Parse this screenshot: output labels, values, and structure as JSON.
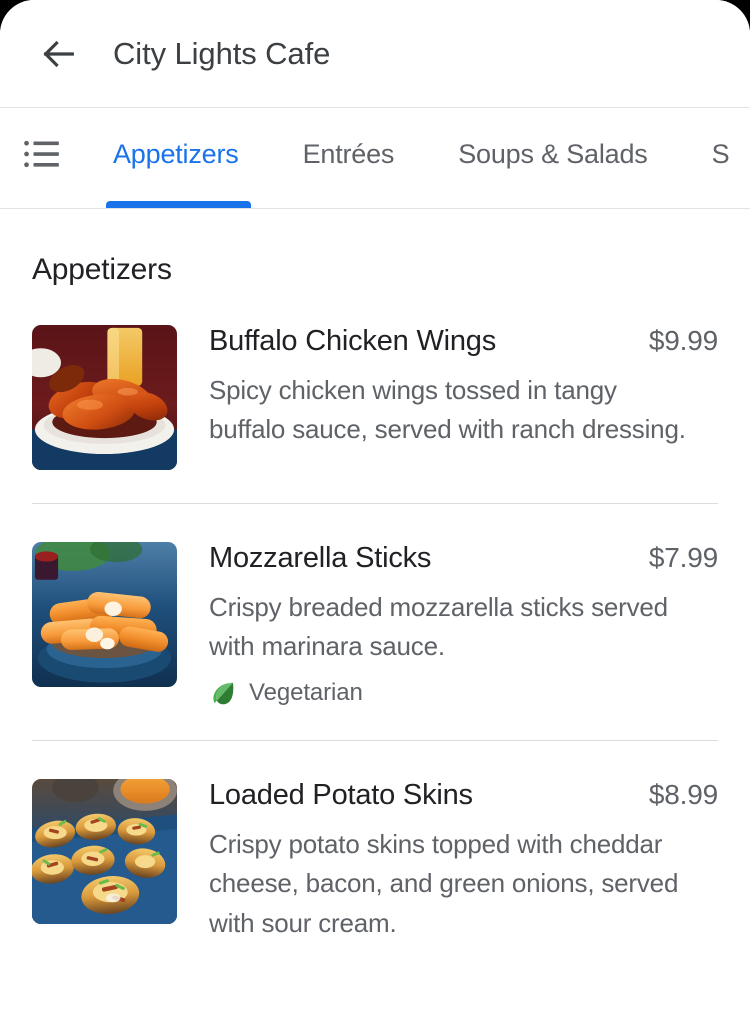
{
  "app": {
    "title": "City Lights Cafe",
    "back_icon": "arrow-left-icon",
    "accent_color": "#1a73e8",
    "text_color": "#3c4043",
    "muted_color": "#5f6368"
  },
  "tabs": {
    "list_icon": "list-bulleted-icon",
    "items": [
      {
        "label": "Appetizers",
        "active": true
      },
      {
        "label": "Entrées",
        "active": false
      },
      {
        "label": "Soups & Salads",
        "active": false
      },
      {
        "label": "S",
        "active": false
      }
    ]
  },
  "section": {
    "title": "Appetizers"
  },
  "menu_items": [
    {
      "name": "Buffalo Chicken Wings",
      "price": "$9.99",
      "description": "Spicy chicken wings tossed in tangy buffalo sauce, served with ranch dressing.",
      "image_name": "buffalo-chicken-wings-photo",
      "tag": null,
      "tag_icon": null
    },
    {
      "name": "Mozzarella Sticks",
      "price": "$7.99",
      "description": "Crispy breaded mozzarella sticks served with marinara sauce.",
      "image_name": "mozzarella-sticks-photo",
      "tag": "Vegetarian",
      "tag_icon": "leaf-icon"
    },
    {
      "name": "Loaded Potato Skins",
      "price": "$8.99",
      "description": "Crispy potato skins topped with cheddar cheese, bacon, and green onions, served with sour cream.",
      "image_name": "loaded-potato-skins-photo",
      "tag": null,
      "tag_icon": null
    }
  ],
  "colors": {
    "leaf_light": "#4caf50",
    "leaf_dark": "#2e7d32",
    "divider": "#dadce0"
  }
}
